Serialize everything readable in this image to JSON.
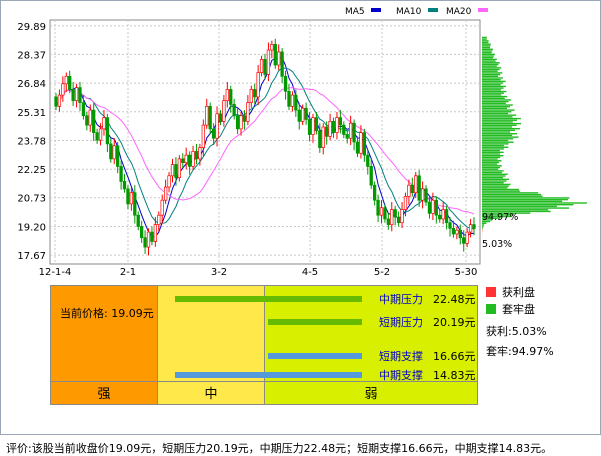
{
  "chart_data": {
    "type": "candlestick",
    "ylim": [
      17.2,
      30.2
    ],
    "y_ticks": [
      "29.89",
      "28.37",
      "26.84",
      "25.31",
      "23.78",
      "22.25",
      "20.73",
      "19.20",
      "17.67"
    ],
    "x_ticks": [
      "12-1-4",
      "2-1",
      "3-2",
      "4-5",
      "5-2",
      "5-30"
    ],
    "legend": [
      {
        "name": "MA5",
        "color": "#0000cc"
      },
      {
        "name": "MA10",
        "color": "#008080"
      },
      {
        "name": "MA20",
        "color": "#ff66ff"
      }
    ],
    "up_color": "#ff0000",
    "down_color": "#009900",
    "chip_labels": {
      "upper": "94.97%",
      "lower": "5.03%"
    },
    "chip_colors": {
      "profit": "#ff3333",
      "locked": "#22bb22"
    },
    "close_series": [
      25.6,
      26.2,
      26.8,
      27.2,
      26.5,
      25.9,
      26.6,
      25.8,
      25.1,
      24.6,
      25.4,
      24.2,
      23.8,
      24.4,
      25.0,
      23.6,
      22.8,
      23.5,
      22.4,
      21.6,
      21.2,
      20.4,
      21.0,
      19.8,
      19.2,
      18.6,
      18.1,
      18.9,
      18.4,
      19.3,
      19.8,
      20.6,
      21.3,
      21.9,
      22.5,
      21.8,
      22.8,
      22.6,
      23.0,
      22.4,
      23.2,
      22.8,
      23.4,
      24.6,
      25.6,
      24.4,
      23.9,
      25.2,
      24.8,
      25.9,
      26.5,
      25.7,
      25.1,
      24.4,
      25.1,
      24.8,
      25.8,
      26.5,
      26.1,
      27.4,
      28.1,
      27.3,
      28.6,
      28.9,
      27.8,
      28.5,
      27.2,
      26.4,
      25.6,
      26.2,
      25.4,
      24.8,
      25.5,
      24.9,
      24.1,
      25.0,
      24.3,
      23.4,
      24.5,
      24.0,
      24.8,
      24.2,
      25.0,
      24.6,
      24.1,
      23.9,
      24.7,
      23.7,
      23.1,
      24.2,
      23.0,
      22.4,
      21.4,
      20.6,
      19.8,
      20.2,
      19.6,
      19.3,
      20.1,
      19.7,
      19.4,
      20.1,
      20.8,
      21.4,
      21.0,
      21.9,
      20.6,
      21.2,
      20.5,
      19.9,
      20.6,
      19.8,
      19.6,
      20.1,
      19.4,
      19.1,
      18.8,
      19.0,
      18.6,
      18.3,
      18.9,
      19.3,
      19.09
    ]
  },
  "levels": [
    {
      "name": "中期压力",
      "value": "22.48元",
      "color": "#66bb00",
      "bar_from": 0.4,
      "bar_to": 1.0
    },
    {
      "name": "短期压力",
      "value": "20.19元",
      "color": "#66bb00",
      "bar_from": 0.7,
      "bar_to": 1.0
    },
    {
      "name": "短期支撑",
      "value": "16.66元",
      "color": "#5599dd",
      "bar_from": 0.7,
      "bar_to": 1.0
    },
    {
      "name": "中期支撑",
      "value": "14.83元",
      "color": "#5599dd",
      "bar_from": 0.4,
      "bar_to": 1.0
    }
  ],
  "panel": {
    "current_price": "当前价格: 19.09元",
    "zones": [
      "强",
      "中",
      "弱"
    ]
  },
  "legend_right": {
    "profit": "获利盘",
    "locked": "套牢盘",
    "profit_pct": "获利:5.03%",
    "locked_pct": "套牢:94.97%"
  },
  "footer": "评价:该股当前收盘价19.09元，短期压力20.19元，中期压力22.48元；短期支撑16.66元，中期支撑14.83元。"
}
